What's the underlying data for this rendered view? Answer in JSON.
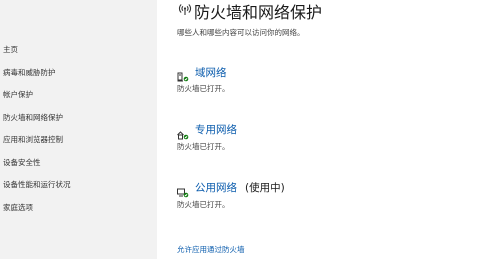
{
  "sidebar": {
    "items": [
      {
        "label": "主页"
      },
      {
        "label": "病毒和威胁防护"
      },
      {
        "label": "帐户保护"
      },
      {
        "label": "防火墙和网络保护"
      },
      {
        "label": "应用和浏览器控制"
      },
      {
        "label": "设备安全性"
      },
      {
        "label": "设备性能和运行状况"
      },
      {
        "label": "家庭选项"
      }
    ]
  },
  "header": {
    "icon": "wifi-antenna-icon",
    "title": "防火墙和网络保护",
    "subtitle": "哪些人和哪些内容可以访问你的网络。"
  },
  "networks": [
    {
      "icon": "domain-network-icon",
      "name": "域网络",
      "suffix": "",
      "status": "防火墙已打开。"
    },
    {
      "icon": "private-network-icon",
      "name": "专用网络",
      "suffix": "",
      "status": "防火墙已打开。"
    },
    {
      "icon": "public-network-icon",
      "name": "公用网络",
      "suffix": "(使用中)",
      "status": "防火墙已打开。"
    }
  ],
  "links": {
    "allow_app": "允许应用通过防火墙"
  },
  "colors": {
    "link": "#0b5cad",
    "sidebar_bg": "#f2f2f2",
    "status_ok": "#107c10"
  }
}
